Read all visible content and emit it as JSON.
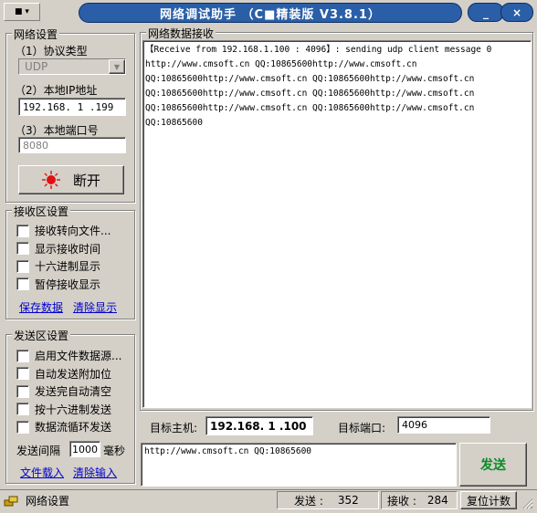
{
  "titlebar": {
    "title": "网络调试助手 （C■精装版 V3.8.1）",
    "menu_glyph": "■ ▾",
    "minimize": "_",
    "close": "×"
  },
  "network": {
    "group_label": "网络设置",
    "protocol_label": "（1）协议类型",
    "protocol_value": "UDP",
    "ip_label": "（2）本地IP地址",
    "ip_value": "192.168. 1 .199",
    "port_label": "（3）本地端口号",
    "port_value": "8080",
    "connect_button": "断开"
  },
  "receive_settings": {
    "group_label": "接收区设置",
    "options": [
      "接收转向文件...",
      "显示接收时间",
      "十六进制显示",
      "暂停接收显示"
    ],
    "save_link": "保存数据",
    "clear_link": "清除显示"
  },
  "send_settings": {
    "group_label": "发送区设置",
    "options": [
      "启用文件数据源...",
      "自动发送附加位",
      "发送完自动清空",
      "按十六进制发送",
      "数据流循环发送"
    ],
    "interval_label": "发送间隔",
    "interval_value": "1000",
    "interval_unit": "毫秒",
    "load_link": "文件载入",
    "clear_link": "清除输入"
  },
  "receive_area": {
    "label": "网络数据接收",
    "lines": [
      "【Receive from 192.168.1.100 : 4096】: sending udp client message 0",
      "http://www.cmsoft.cn QQ:10865600http://www.cmsoft.cn",
      "QQ:10865600http://www.cmsoft.cn QQ:10865600http://www.cmsoft.cn",
      "QQ:10865600http://www.cmsoft.cn QQ:10865600http://www.cmsoft.cn",
      "QQ:10865600http://www.cmsoft.cn QQ:10865600http://www.cmsoft.cn",
      "QQ:10865600"
    ]
  },
  "target": {
    "host_label": "目标主机:",
    "host_value": "192.168. 1 .100",
    "port_label": "目标端口:",
    "port_value": "4096"
  },
  "send_area": {
    "text": "http://www.cmsoft.cn QQ:10865600",
    "send_button": "发送"
  },
  "statusbar": {
    "mode": "网络设置",
    "sent_label": "发送 :",
    "sent_value": "352",
    "recv_label": "接收 :",
    "recv_value": "284",
    "reset_button": "复位计数"
  }
}
